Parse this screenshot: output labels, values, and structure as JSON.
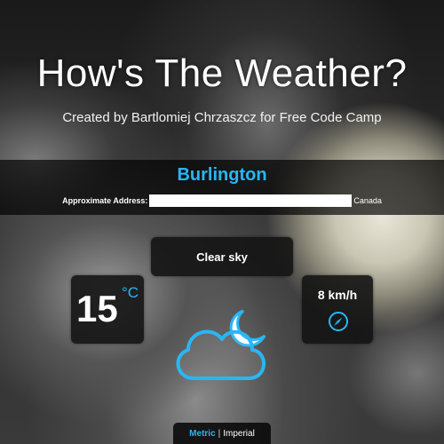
{
  "header": {
    "title": "How's The Weather?",
    "subtitle": "Created by Bartlomiej Chrzaszcz for Free Code Camp"
  },
  "location": {
    "city": "Burlington",
    "address_label": "Approximate Address:",
    "address_value": "",
    "country": "Canada"
  },
  "weather": {
    "description": "Clear sky",
    "temperature": "15",
    "temperature_unit": "°C",
    "wind_speed": "8 km/h",
    "icon": "partly-cloudy-night-icon"
  },
  "units": {
    "metric": "Metric",
    "separator": "|",
    "imperial": "Imperial",
    "selected": "metric"
  },
  "colors": {
    "accent": "#29b6f6",
    "panel_bg": "#141414"
  }
}
